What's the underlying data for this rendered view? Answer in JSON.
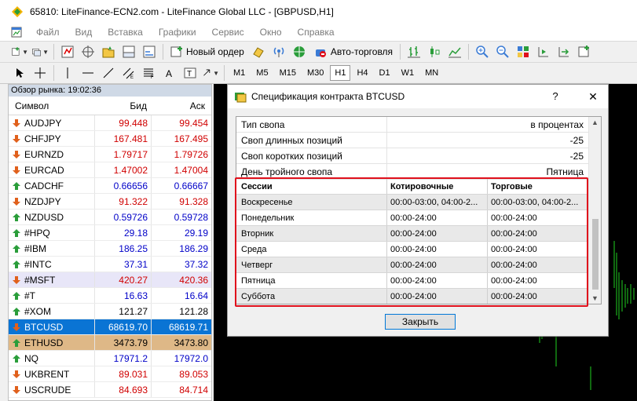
{
  "window": {
    "title": "65810: LiteFinance-ECN2.com - LiteFinance Global LLC - [GBPUSD,H1]"
  },
  "menu": [
    "Файл",
    "Вид",
    "Вставка",
    "Графики",
    "Сервис",
    "Окно",
    "Справка"
  ],
  "toolbar": {
    "new_order": "Новый ордер",
    "auto_trading": "Авто-торговля"
  },
  "timeframes": [
    "M1",
    "M5",
    "M15",
    "M30",
    "H1",
    "H4",
    "D1",
    "W1",
    "MN"
  ],
  "active_timeframe": "H1",
  "market_watch": {
    "header": "Обзор рынка: 19:02:36",
    "columns": {
      "symbol": "Символ",
      "bid": "Бид",
      "ask": "Аск"
    },
    "rows": [
      {
        "symbol": "AUDJPY",
        "bid": "99.448",
        "ask": "99.454",
        "dir": "down",
        "color": "red"
      },
      {
        "symbol": "CHFJPY",
        "bid": "167.481",
        "ask": "167.495",
        "dir": "down",
        "color": "red"
      },
      {
        "symbol": "EURNZD",
        "bid": "1.79717",
        "ask": "1.79726",
        "dir": "down",
        "color": "red"
      },
      {
        "symbol": "EURCAD",
        "bid": "1.47002",
        "ask": "1.47004",
        "dir": "down",
        "color": "red"
      },
      {
        "symbol": "CADCHF",
        "bid": "0.66656",
        "ask": "0.66667",
        "dir": "up",
        "color": "blue"
      },
      {
        "symbol": "NZDJPY",
        "bid": "91.322",
        "ask": "91.328",
        "dir": "down",
        "color": "red"
      },
      {
        "symbol": "NZDUSD",
        "bid": "0.59726",
        "ask": "0.59728",
        "dir": "up",
        "color": "blue"
      },
      {
        "symbol": "#HPQ",
        "bid": "29.18",
        "ask": "29.19",
        "dir": "up",
        "color": "blue"
      },
      {
        "symbol": "#IBM",
        "bid": "186.25",
        "ask": "186.29",
        "dir": "up",
        "color": "blue"
      },
      {
        "symbol": "#INTC",
        "bid": "37.31",
        "ask": "37.32",
        "dir": "up",
        "color": "blue"
      },
      {
        "symbol": "#MSFT",
        "bid": "420.27",
        "ask": "420.36",
        "dir": "down",
        "color": "red"
      },
      {
        "symbol": "#T",
        "bid": "16.63",
        "ask": "16.64",
        "dir": "up",
        "color": "blue"
      },
      {
        "symbol": "#XOM",
        "bid": "121.27",
        "ask": "121.28",
        "dir": "up",
        "color": "black"
      },
      {
        "symbol": "BTCUSD",
        "bid": "68619.70",
        "ask": "68619.71",
        "dir": "down",
        "color": "selected"
      },
      {
        "symbol": "ETHUSD",
        "bid": "3473.79",
        "ask": "3473.80",
        "dir": "up",
        "color": "tan"
      },
      {
        "symbol": "NQ",
        "bid": "17971.2",
        "ask": "17972.0",
        "dir": "up",
        "color": "blue"
      },
      {
        "symbol": "UKBRENT",
        "bid": "89.031",
        "ask": "89.053",
        "dir": "down",
        "color": "red"
      },
      {
        "symbol": "USCRUDE",
        "bid": "84.693",
        "ask": "84.714",
        "dir": "down",
        "color": "red"
      }
    ]
  },
  "dialog": {
    "title": "Спецификация контракта BTCUSD",
    "help": "?",
    "close_x": "✕",
    "properties": [
      {
        "key": "Тип свопа",
        "value": "в процентах"
      },
      {
        "key": "Своп длинных позиций",
        "value": "-25"
      },
      {
        "key": "Своп коротких позиций",
        "value": "-25"
      },
      {
        "key": "День тройного свопа",
        "value": "Пятница"
      }
    ],
    "sessions": {
      "headers": {
        "day": "Сессии",
        "quote": "Котировочные",
        "trade": "Торговые"
      },
      "rows": [
        {
          "day": "Воскресенье",
          "quote": "00:00-03:00, 04:00-2...",
          "trade": "00:00-03:00, 04:00-2..."
        },
        {
          "day": "Понедельник",
          "quote": "00:00-24:00",
          "trade": "00:00-24:00"
        },
        {
          "day": "Вторник",
          "quote": "00:00-24:00",
          "trade": "00:00-24:00"
        },
        {
          "day": "Среда",
          "quote": "00:00-24:00",
          "trade": "00:00-24:00"
        },
        {
          "day": "Четверг",
          "quote": "00:00-24:00",
          "trade": "00:00-24:00"
        },
        {
          "day": "Пятница",
          "quote": "00:00-24:00",
          "trade": "00:00-24:00"
        },
        {
          "day": "Суббота",
          "quote": "00:00-24:00",
          "trade": "00:00-24:00"
        }
      ]
    },
    "close_button": "Закрыть"
  },
  "colors": {
    "selected_row": "#0a74d4",
    "tan_row": "#deb887",
    "highlight_frame": "#e0101c",
    "bid_red": "#d00000",
    "bid_blue": "#0000c8"
  }
}
